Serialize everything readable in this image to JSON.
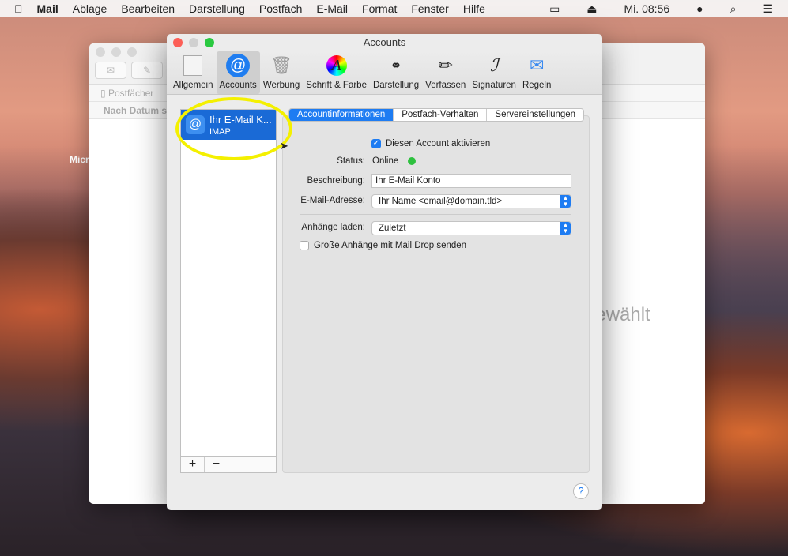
{
  "menubar": {
    "app": "Mail",
    "items": [
      "Ablage",
      "Bearbeiten",
      "Darstellung",
      "Postfach",
      "E-Mail",
      "Format",
      "Fenster",
      "Hilfe"
    ],
    "clock": "Mi. 08:56"
  },
  "background_window": {
    "mailboxes": "Postfächer",
    "sort": "Nach Datum so",
    "empty_text": "sgewählt",
    "desktop_label": "Micr"
  },
  "window": {
    "title": "Accounts",
    "toolbar": [
      {
        "label": "Allgemein",
        "icon": "switch-icon"
      },
      {
        "label": "Accounts",
        "icon": "at-icon"
      },
      {
        "label": "Werbung",
        "icon": "junk-icon"
      },
      {
        "label": "Schrift & Farbe",
        "icon": "font-icon"
      },
      {
        "label": "Darstellung",
        "icon": "glasses-icon"
      },
      {
        "label": "Verfassen",
        "icon": "pencil-icon"
      },
      {
        "label": "Signaturen",
        "icon": "signature-icon"
      },
      {
        "label": "Regeln",
        "icon": "rules-icon"
      }
    ],
    "active_tab": "Accounts",
    "account": {
      "name": "Ihr E-Mail K...",
      "type": "IMAP"
    },
    "list_buttons": {
      "add": "+",
      "remove": "−"
    },
    "tabs": [
      "Accountinformationen",
      "Postfach-Verhalten",
      "Servereinstellungen"
    ],
    "form": {
      "enable_label": "Diesen Account aktivieren",
      "enabled": true,
      "status_label": "Status:",
      "status_value": "Online",
      "status_color": "#2ec13f",
      "description_label": "Beschreibung:",
      "description_value": "Ihr E-Mail Konto",
      "email_label": "E-Mail-Adresse:",
      "email_value": "Ihr Name <email@domain.tld>",
      "attachments_label": "Anhänge laden:",
      "attachments_value": "Zuletzt",
      "maildrop_label": "Große Anhänge mit Mail Drop senden",
      "maildrop": false
    },
    "help": "?"
  }
}
